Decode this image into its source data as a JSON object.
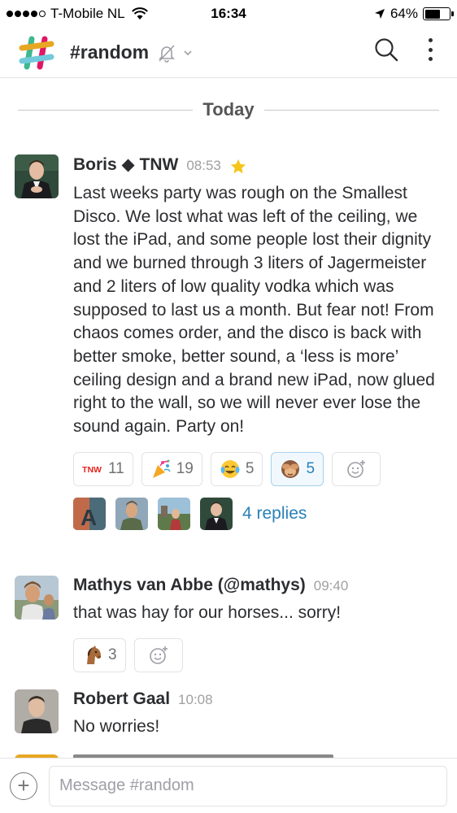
{
  "status_bar": {
    "carrier": "T-Mobile NL",
    "time": "16:34",
    "battery_text": "64%",
    "battery_level": 0.64
  },
  "header": {
    "channel_name": "#random",
    "icons": [
      "slack-logo-icon",
      "mute-icon",
      "chevron-down-icon",
      "search-icon",
      "more-vertical-icon"
    ]
  },
  "day_divider": {
    "label": "Today"
  },
  "messages": [
    {
      "author": "Boris ◆ TNW",
      "time": "08:53",
      "text": "Last weeks party was rough on the Smallest Disco. We lost what was left of the ceiling, we lost the iPad, and some people lost their dignity and we burned through 3 liters of Jagermeister and 2 liters of low quality vodka which was supposed to last us a month. But fear not! From chaos comes order, and the disco is back with better smoke, better sound, a ‘less is more’ ceiling design and a brand new iPad, now glued right to the wall, so we will never ever lose the sound again. Party on!",
      "reactions": [
        {
          "emoji": "tnw-icon",
          "count": "11"
        },
        {
          "emoji": "party-popper-icon",
          "count": "19"
        },
        {
          "emoji": "joy-icon",
          "count": "5"
        },
        {
          "emoji": "see-no-evil-monkey-icon",
          "count": "5"
        }
      ],
      "replies_label": "4 replies"
    },
    {
      "author": "Mathys van Abbe (@mathys)",
      "time": "09:40",
      "text": "that was hay for our horses... sorry!",
      "reactions": [
        {
          "emoji": "horse-icon",
          "count": "3"
        }
      ]
    },
    {
      "author": "Robert Gaal",
      "time": "10:08",
      "text": "No worries!"
    }
  ],
  "composer": {
    "placeholder": "Message #random"
  },
  "colors": {
    "link": "#2a80b9",
    "active_reaction_bg": "#f1f8fd",
    "active_reaction_border": "#a7d1ec",
    "star": "#f5c518"
  }
}
